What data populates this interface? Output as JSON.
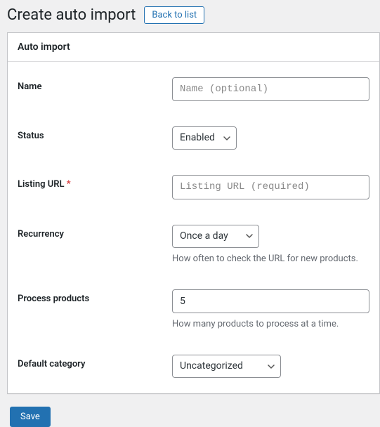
{
  "header": {
    "title": "Create auto import",
    "back_label": "Back to list"
  },
  "panel": {
    "title": "Auto import"
  },
  "form": {
    "name": {
      "label": "Name",
      "placeholder": "Name (optional)",
      "value": ""
    },
    "status": {
      "label": "Status",
      "value": "Enabled"
    },
    "listing_url": {
      "label": "Listing URL",
      "required_mark": "*",
      "placeholder": "Listing URL (required)",
      "value": ""
    },
    "recurrency": {
      "label": "Recurrency",
      "value": "Once a day",
      "help": "How often to check the URL for new products."
    },
    "process_products": {
      "label": "Process products",
      "value": "5",
      "help": "How many products to process at a time."
    },
    "default_category": {
      "label": "Default category",
      "value": "Uncategorized"
    }
  },
  "actions": {
    "save_label": "Save"
  }
}
